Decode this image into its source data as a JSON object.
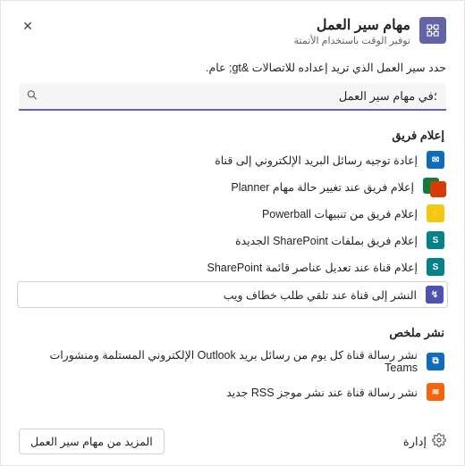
{
  "header": {
    "title": "مهام سير العمل",
    "subtitle": "توفير الوقت باستخدام الأتمتة"
  },
  "instruction": "حدد سير العمل الذي تريد إعداده للاتصالات &gt; عام.",
  "search": {
    "value": "؛في مهام سير العمل",
    "placeholder": "البحث"
  },
  "sections": [
    {
      "title": "إعلام فريق",
      "items": [
        {
          "label": "إعادة توجيه رسائل البريد الإلكتروني إلى قناة",
          "icon_bg": "#0f6cbd",
          "icon_glyph": "✉"
        },
        {
          "label": "إعلام فريق عند تغيير حالة مهام Planner",
          "icon_dual": true
        },
        {
          "label": "إعلام فريق من تنبيهات Powerball",
          "icon_bg": "#f2c811",
          "icon_glyph": "⚡"
        },
        {
          "label": "إعلام فريق بملفات SharePoint الجديدة",
          "icon_bg": "#038387",
          "icon_glyph": "S"
        },
        {
          "label": "إعلام قناة عند تعديل عناصر قائمة SharePoint",
          "icon_bg": "#038387",
          "icon_glyph": "S"
        },
        {
          "label": "النشر إلى قناة عند تلقي طلب خطاف ويب",
          "icon_bg": "#4f52b2",
          "icon_glyph": "↯",
          "highlight": true
        }
      ]
    },
    {
      "title": "نشر ملخص",
      "items": [
        {
          "label": "نشر رسالة قناة كل يوم من رسائل بريد Outlook الإلكتروني المستلمة ومنشورات Teams",
          "icon_bg": "#0f6cbd",
          "icon_glyph": "⧉"
        },
        {
          "label": "نشر رسالة قناة عند نشر موجز RSS جديد",
          "icon_bg": "#f7630c",
          "icon_glyph": "≋"
        }
      ]
    }
  ],
  "footer": {
    "manage_label": "إدارة",
    "more_button": "المزيد من مهام سير العمل"
  }
}
